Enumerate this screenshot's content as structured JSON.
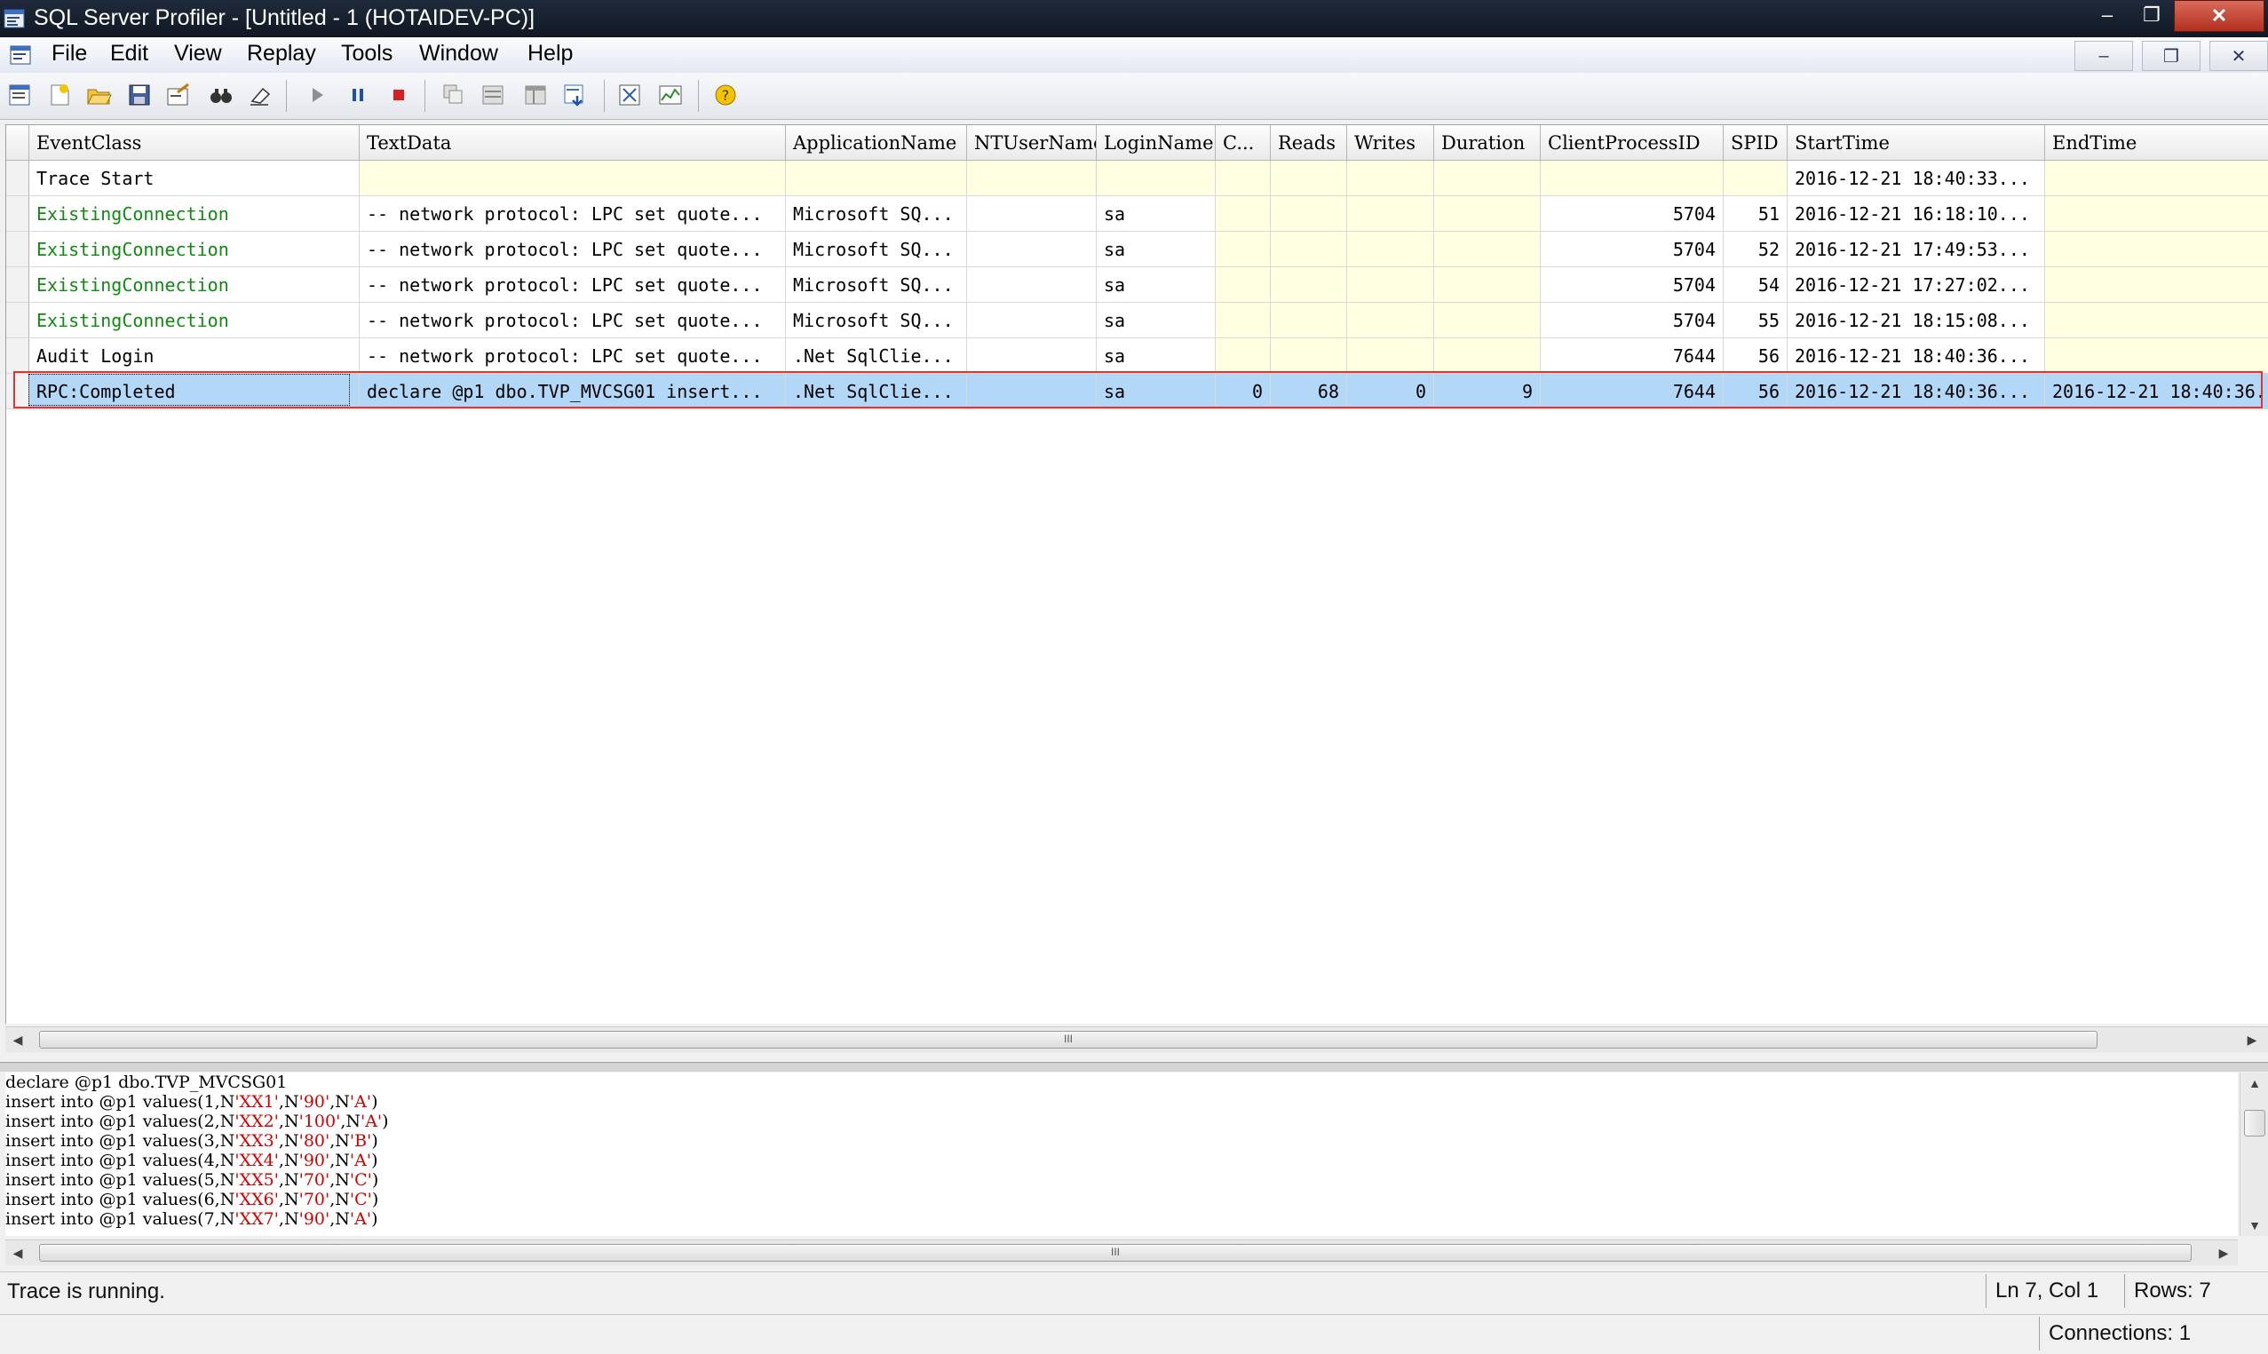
{
  "window": {
    "title": "SQL Server Profiler - [Untitled - 1 (HOTAIDEV-PC)]",
    "min_glyph": "–",
    "max_glyph": "❐",
    "close_glyph": "✕"
  },
  "menu": {
    "items": [
      "File",
      "Edit",
      "View",
      "Replay",
      "Tools",
      "Window",
      "Help"
    ],
    "mdi_min": "–",
    "mdi_restore": "❐",
    "mdi_close": "✕"
  },
  "toolbar": {
    "buttons": [
      "new-trace-icon",
      "new-template-icon",
      "open-icon",
      "save-icon",
      "properties-icon",
      "find-icon",
      "clear-icon",
      "start-icon",
      "pause-icon",
      "stop-icon",
      "aggregate-icon",
      "grouped-view-icon",
      "columns-icon",
      "auto-scroll-icon",
      "open-db-engine-icon",
      "performance-monitor-icon",
      "help-icon"
    ]
  },
  "grid": {
    "columns": [
      "EventClass",
      "TextData",
      "ApplicationName",
      "NTUserName",
      "LoginName",
      "C...",
      "Reads",
      "Writes",
      "Duration",
      "ClientProcessID",
      "SPID",
      "StartTime",
      "EndTime"
    ],
    "rows": [
      [
        "Trace Start",
        "",
        "",
        "",
        "",
        "",
        "",
        "",
        "",
        "",
        "",
        "2016-12-21 18:40:33...",
        ""
      ],
      [
        "ExistingConnection",
        "-- network protocol: LPC  set quote...",
        "Microsoft SQ...",
        "",
        "sa",
        "",
        "",
        "",
        "",
        "5704",
        "51",
        "2016-12-21 16:18:10...",
        ""
      ],
      [
        "ExistingConnection",
        "-- network protocol: LPC  set quote...",
        "Microsoft SQ...",
        "",
        "sa",
        "",
        "",
        "",
        "",
        "5704",
        "52",
        "2016-12-21 17:49:53...",
        ""
      ],
      [
        "ExistingConnection",
        "-- network protocol: LPC  set quote...",
        "Microsoft SQ...",
        "",
        "sa",
        "",
        "",
        "",
        "",
        "5704",
        "54",
        "2016-12-21 17:27:02...",
        ""
      ],
      [
        "ExistingConnection",
        "-- network protocol: LPC  set quote...",
        "Microsoft SQ...",
        "",
        "sa",
        "",
        "",
        "",
        "",
        "5704",
        "55",
        "2016-12-21 18:15:08...",
        ""
      ],
      [
        "Audit Login",
        "-- network protocol: LPC  set quote...",
        ".Net SqlClie...",
        "",
        "sa",
        "",
        "",
        "",
        "",
        "7644",
        "56",
        "2016-12-21 18:40:36...",
        ""
      ],
      [
        "RPC:Completed",
        "declare @p1 dbo.TVP_MVCSG01  insert...",
        ".Net SqlClie...",
        "",
        "sa",
        "0",
        "68",
        "0",
        "9",
        "7644",
        "56",
        "2016-12-21 18:40:36...",
        "2016-12-21 18:40:36."
      ]
    ],
    "selected_row": 6,
    "green_color": "#118a11",
    "selection_color": "#b3d7f7"
  },
  "textdata": {
    "lines": [
      {
        "plain": "declare @p1 dbo.TVP_MVCSG01",
        "parts": []
      },
      {
        "parts": [
          "insert into @p1 values(1,N",
          "'XX1'",
          ",N",
          "'90'",
          ",N",
          "'A'",
          ")"
        ]
      },
      {
        "parts": [
          "insert into @p1 values(2,N",
          "'XX2'",
          ",N",
          "'100'",
          ",N",
          "'A'",
          ")"
        ]
      },
      {
        "parts": [
          "insert into @p1 values(3,N",
          "'XX3'",
          ",N",
          "'80'",
          ",N",
          "'B'",
          ")"
        ]
      },
      {
        "parts": [
          "insert into @p1 values(4,N",
          "'XX4'",
          ",N",
          "'90'",
          ",N",
          "'A'",
          ")"
        ]
      },
      {
        "parts": [
          "insert into @p1 values(5,N",
          "'XX5'",
          ",N",
          "'70'",
          ",N",
          "'C'",
          ")"
        ]
      },
      {
        "parts": [
          "insert into @p1 values(6,N",
          "'XX6'",
          ",N",
          "'70'",
          ",N",
          "'C'",
          ")"
        ]
      },
      {
        "parts": [
          "insert into @p1 values(7,N",
          "'XX7'",
          ",N",
          "'90'",
          ",N",
          "'A'",
          ")"
        ]
      }
    ]
  },
  "scroll": {
    "left_arrow": "◀",
    "right_arrow": "▶",
    "up_arrow": "▲",
    "down_arrow": "▼",
    "grip": "III"
  },
  "status": {
    "message": "Trace is running.",
    "position": "Ln 7, Col 1",
    "rows": "Rows: 7",
    "connections": "Connections: 1"
  }
}
